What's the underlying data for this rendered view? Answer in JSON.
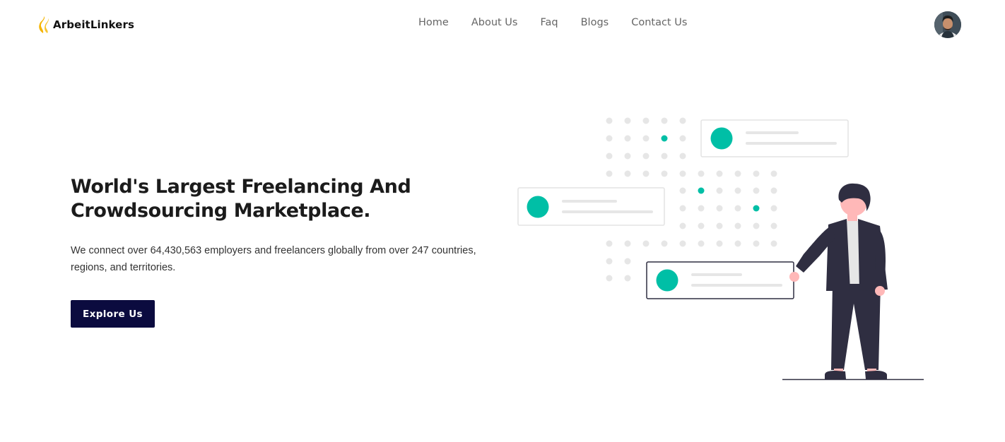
{
  "brand": {
    "name": "ArbeitLinkers",
    "icon": "flame-logo-icon",
    "icon_color": "#F5B400"
  },
  "nav": {
    "items": [
      {
        "label": "Home"
      },
      {
        "label": "About Us"
      },
      {
        "label": "Faq"
      },
      {
        "label": "Blogs"
      },
      {
        "label": "Contact Us"
      }
    ]
  },
  "user": {
    "avatar": "user-avatar"
  },
  "hero": {
    "title_line1": "World's Largest Freelancing And",
    "title_line2": "Crowdsourcing Marketplace.",
    "description": "We connect over 64,430,563 employers and freelancers globally from over 247 countries, regions, and territories.",
    "cta_label": "Explore Us"
  },
  "illustration": {
    "icon": "person-presenting-cards-illustration",
    "accent_color": "#00BFA6",
    "dark_color": "#2F2E41",
    "skin_color": "#FFB8B8",
    "dot_color": "#E6E6E6"
  },
  "colors": {
    "button_bg": "#0B0B3F",
    "nav_text": "#666666"
  }
}
